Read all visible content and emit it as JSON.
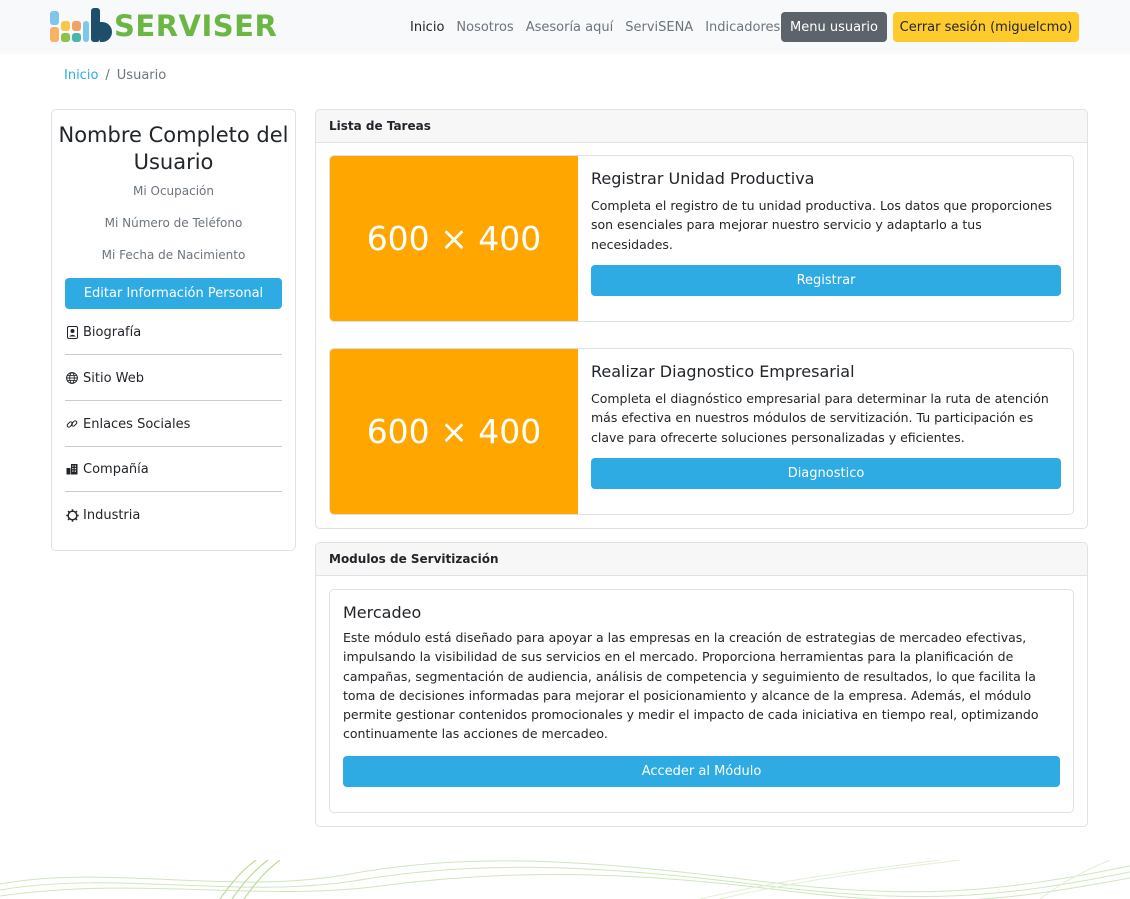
{
  "brand": {
    "logo_text": "SERVISER",
    "accent_green": "#6cb644",
    "accent_blue": "#2dabe2",
    "accent_orange": "#ffa600"
  },
  "nav": {
    "links": [
      "Inicio",
      "Nosotros",
      "Asesoría aquí",
      "ServiSENA",
      "Indicadores"
    ],
    "menu_button": "Menu usuario",
    "logout_button": "Cerrar sesión (miguelcmo)"
  },
  "breadcrumb": {
    "home": "Inicio",
    "separator": "/",
    "current": "Usuario"
  },
  "profile": {
    "name": "Nombre Completo del Usuario",
    "occupation": "Mi Ocupación",
    "phone": "Mi Número de Teléfono",
    "birthdate": "Mi Fecha de Nacimiento",
    "edit_button": "Editar Información Personal",
    "items": [
      {
        "icon": "person-badge-icon",
        "label": "Biografía"
      },
      {
        "icon": "globe-icon",
        "label": "Sitio Web"
      },
      {
        "icon": "link-icon",
        "label": "Enlaces Sociales"
      },
      {
        "icon": "building-icon",
        "label": "Compañía"
      },
      {
        "icon": "gear-icon",
        "label": "Industria"
      }
    ]
  },
  "tasks": {
    "header": "Lista de Tareas",
    "items": [
      {
        "image_label": "600 × 400",
        "title": "Registrar Unidad Productiva",
        "text": "Completa el registro de tu unidad productiva. Los datos que proporciones son esenciales para mejorar nuestro servicio y adaptarlo a tus necesidades.",
        "button": "Registrar"
      },
      {
        "image_label": "600 × 400",
        "title": "Realizar Diagnostico Empresarial",
        "text": "Completa el diagnóstico empresarial para determinar la ruta de atención más efectiva en nuestros módulos de servitización. Tu participación es clave para ofrecerte soluciones personalizadas y eficientes.",
        "button": "Diagnostico"
      }
    ]
  },
  "modules": {
    "header": "Modulos de Servitización",
    "items": [
      {
        "title": "Mercadeo",
        "text": "Este módulo está diseñado para apoyar a las empresas en la creación de estrategias de mercadeo efectivas, impulsando la visibilidad de sus servicios en el mercado. Proporciona herramientas para la planificación de campañas, segmentación de audiencia, análisis de competencia y seguimiento de resultados, lo que facilita la toma de decisiones informadas para mejorar el posicionamiento y alcance de la empresa. Además, el módulo permite gestionar contenidos promocionales y medir el impacto de cada iniciativa en tiempo real, optimizando continuamente las acciones de mercadeo.",
        "button": "Acceder al Módulo"
      }
    ]
  }
}
